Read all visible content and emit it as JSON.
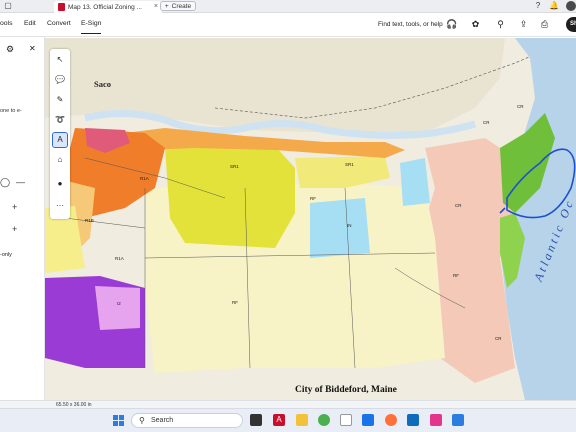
{
  "browser": {
    "doc_tab_title": "Map 13. Official Zoning ...",
    "create_label": "Create",
    "tab_close_glyph": "×",
    "create_glyph": "+"
  },
  "menubar": {
    "items": [
      "ools",
      "Edit",
      "Convert",
      "E-Sign"
    ],
    "find_text": "Find text, tools, or help",
    "share_label": "Sh"
  },
  "left_panel": {
    "partial_text": [
      "one to e-",
      "-only"
    ],
    "symbols": [
      "◯",
      "—",
      "+",
      "+"
    ]
  },
  "tool_rail": {
    "icons": [
      "select-arrow-icon",
      "comment-icon",
      "pen-icon",
      "draw-lasso-icon",
      "text-select-icon",
      "stamp-icon",
      "color-dot-icon",
      "more-icon"
    ],
    "glyphs": [
      "↖",
      "💬",
      "✎",
      "➰",
      "A",
      "⌂",
      "●",
      "···"
    ]
  },
  "map": {
    "place_label": "Saco",
    "title": "City of Biddeford, Maine",
    "ocean_label": "Atlantic Oc",
    "zone_labels": [
      "SR1",
      "SR1",
      "R1A",
      "R1A",
      "RF",
      "RF",
      "RF",
      "I2",
      "CR",
      "CR",
      "CR",
      "IN",
      "R1B",
      "CR"
    ],
    "colors": {
      "rural": "#f8f3c6",
      "suburban": "#e3e23a",
      "industrial_light": "#a6def4",
      "industrial_dark": "#9b3bd6",
      "commercial": "#f07d2a",
      "coastal": "#f4c9b8",
      "water_saco": "#cfe2f1",
      "ocean": "#b7d3ea",
      "green": "#6fbf3a",
      "annotation": "#1d4fd0"
    }
  },
  "status": {
    "page_size": "65.50 x 36.00 in"
  },
  "taskbar": {
    "search_label": "Search",
    "apps": [
      "file-explorer",
      "acrobat",
      "file-manager",
      "chrome",
      "mail",
      "firefox",
      "outlook",
      "photos",
      "store"
    ]
  }
}
